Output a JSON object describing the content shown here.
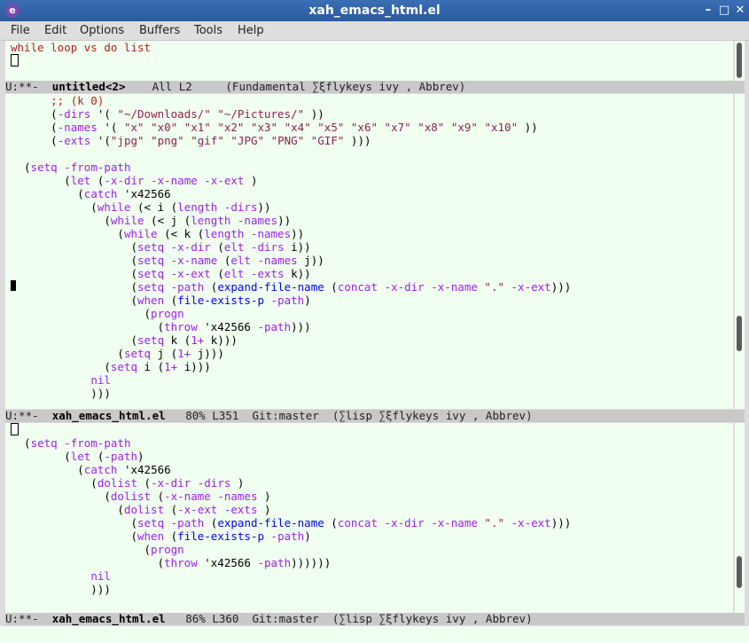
{
  "window": {
    "title": "xah_emacs_html.el",
    "icon_glyph": "e",
    "min_glyph": "–",
    "max_glyph": "□",
    "close_glyph": "✕"
  },
  "menu": [
    "File",
    "Edit",
    "Options",
    "Buffers",
    "Tools",
    "Help"
  ],
  "top_buffer": {
    "line1": "while loop vs do list"
  },
  "modeline1": {
    "state": "U:**-",
    "buffer": "untitled<2>",
    "position": "All L2",
    "modes": "(Fundamental ∑ξflykeys ivy , Abbrev)"
  },
  "middle_code": [
    "      ;; (k 0)",
    "      (-dirs '( \"~/Downloads/\" \"~/Pictures/\" ))",
    "      (-names '( \"x\" \"x0\" \"x1\" \"x2\" \"x3\" \"x4\" \"x5\" \"x6\" \"x7\" \"x8\" \"x9\" \"x10\" ))",
    "      (-exts '(\"jpg\" \"png\" \"gif\" \"JPG\" \"PNG\" \"GIF\" )))",
    "",
    "  (setq -from-path",
    "        (let (-x-dir -x-name -x-ext )",
    "          (catch 'x42566",
    "            (while (< i (length -dirs))",
    "              (while (< j (length -names))",
    "                (while (< k (length -names))",
    "                  (setq -x-dir (elt -dirs i))",
    "                  (setq -x-name (elt -names j))",
    "                  (setq -x-ext (elt -exts k))",
    "                  (setq -path (expand-file-name (concat -x-dir -x-name \".\" -x-ext)))",
    "                  (when (file-exists-p -path)",
    "                    (progn",
    "                      (throw 'x42566 -path)))",
    "                  (setq k (1+ k)))",
    "                (setq j (1+ j)))",
    "              (setq i (1+ i)))",
    "            nil",
    "            )))"
  ],
  "modeline2": {
    "state": "U:**-",
    "buffer": "xah_emacs_html.el",
    "position": "80% L351",
    "vc": "Git:master",
    "modes": "(∑lisp ∑ξflykeys ivy , Abbrev)"
  },
  "bottom_code": [
    "",
    "  (setq -from-path",
    "        (let (-path)",
    "          (catch 'x42566",
    "            (dolist (-x-dir -dirs )",
    "              (dolist (-x-name -names )",
    "                (dolist (-x-ext -exts )",
    "                  (setq -path (expand-file-name (concat -x-dir -x-name \".\" -x-ext)))",
    "                  (when (file-exists-p -path)",
    "                    (progn",
    "                      (throw 'x42566 -path))))))",
    "            nil",
    "            )))"
  ],
  "modeline3": {
    "state": "U:**-",
    "buffer": "xah_emacs_html.el",
    "position": "86% L360",
    "vc": "Git:master",
    "modes": "(∑lisp ∑ξflykeys ivy , Abbrev)"
  }
}
